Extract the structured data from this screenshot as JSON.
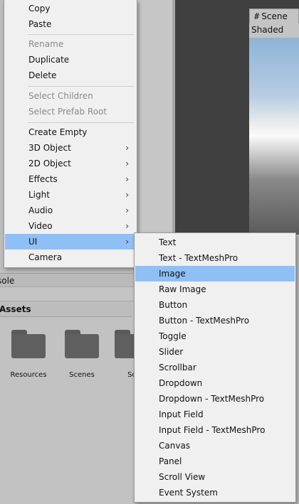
{
  "context_menu": {
    "groups": [
      [
        {
          "label": "Copy",
          "enabled": true
        },
        {
          "label": "Paste",
          "enabled": true
        }
      ],
      [
        {
          "label": "Rename",
          "enabled": false
        },
        {
          "label": "Duplicate",
          "enabled": true
        },
        {
          "label": "Delete",
          "enabled": true
        }
      ],
      [
        {
          "label": "Select Children",
          "enabled": false
        },
        {
          "label": "Select Prefab Root",
          "enabled": false
        }
      ],
      [
        {
          "label": "Create Empty",
          "enabled": true
        },
        {
          "label": "3D Object",
          "submenu": true,
          "arrow": "›"
        },
        {
          "label": "2D Object",
          "submenu": true,
          "arrow": "›"
        },
        {
          "label": "Effects",
          "submenu": true,
          "arrow": "›"
        },
        {
          "label": "Light",
          "submenu": true,
          "arrow": "›"
        },
        {
          "label": "Audio",
          "submenu": true,
          "arrow": "›"
        },
        {
          "label": "Video",
          "submenu": true,
          "arrow": "›"
        },
        {
          "label": "UI",
          "submenu": true,
          "arrow": "›",
          "active": true
        },
        {
          "label": "Camera",
          "enabled": true
        }
      ]
    ]
  },
  "ui_submenu": {
    "highlighted": "Image",
    "items": [
      "Text",
      "Text - TextMeshPro",
      "Image",
      "Raw Image",
      "Button",
      "Button - TextMeshPro",
      "Toggle",
      "Slider",
      "Scrollbar",
      "Dropdown",
      "Dropdown - TextMeshPro",
      "Input Field",
      "Input Field - TextMeshPro",
      "Canvas",
      "Panel",
      "Scroll View",
      "Event System"
    ]
  },
  "scene": {
    "tab_icon": "#",
    "tab_label": "Scene",
    "shading_mode": "Shaded"
  },
  "console": {
    "tab_label": "sole"
  },
  "project": {
    "header": "Assets",
    "folders": [
      "Resources",
      "Scenes",
      "Sc"
    ]
  },
  "colors": {
    "menu_bg": "#f0f0f0",
    "highlight": "#8ec0f5",
    "disabled_text": "#8a8a8a",
    "editor_bg": "#c2c2c2",
    "folder_icon": "#5f5f5f"
  }
}
